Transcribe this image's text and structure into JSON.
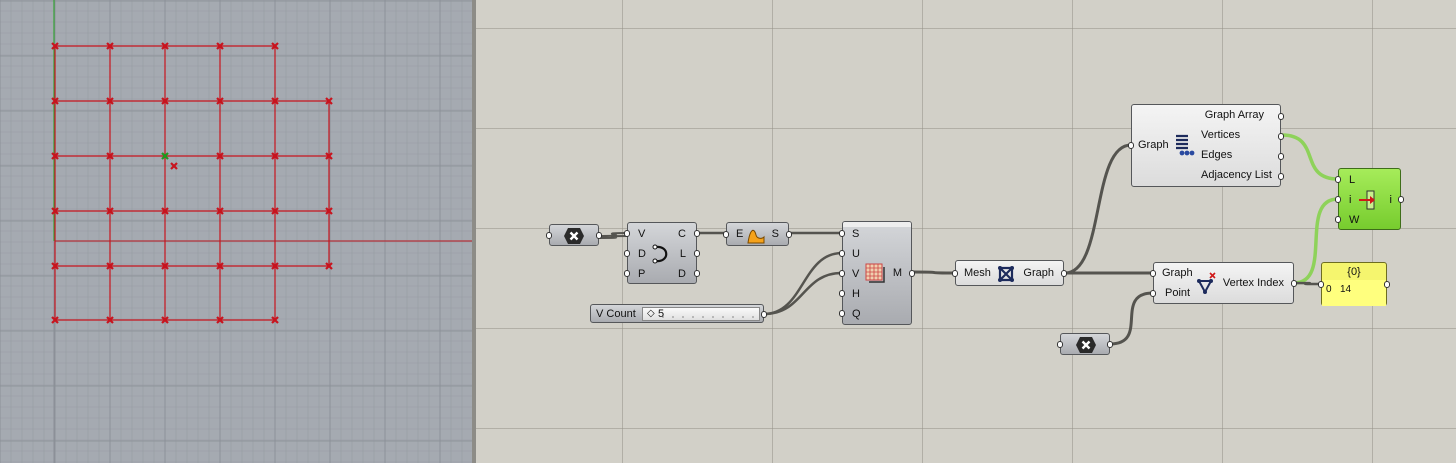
{
  "colors": {
    "viewport_bg": "#a5aab1",
    "grid_point": "#c8141e",
    "selected_point": "#1e9a1e",
    "canvas_bg": "#d2d0c8",
    "wire": "#55544f",
    "panel_yellow": "#f5f56e",
    "component_green": "#8fdc46"
  },
  "viewport": {
    "point_columns": 6,
    "point_rows": 6,
    "selected_point": "column 3, row 3"
  },
  "components": {
    "pt_param": {
      "icon": "cross-hex-icon"
    },
    "deconstruct": {
      "inputs": [
        "V",
        "D",
        "P"
      ],
      "outputs": [
        "C",
        "L",
        "D"
      ],
      "icon": "curve-icon"
    },
    "expression": {
      "input": "E",
      "output": "S",
      "icon": "orange-shape-icon"
    },
    "mesh_grid": {
      "inputs": [
        "S",
        "U",
        "V",
        "H",
        "Q"
      ],
      "output": "M",
      "icon": "mesh-grid-icon"
    },
    "v_count_slider": {
      "label": "V Count",
      "value": "5"
    },
    "mesh_to_graph": {
      "input": "Mesh",
      "output": "Graph",
      "icon": "mesh-graph-icon"
    },
    "deconstruct_graph": {
      "input": "Graph",
      "outputs": [
        "Graph Array",
        "Vertices",
        "Edges",
        "Adjacency List"
      ],
      "icon": "graph-list-icon"
    },
    "vertex_index": {
      "inputs": [
        "Graph",
        "Point"
      ],
      "output": "Vertex Index",
      "icon": "vertex-index-icon"
    },
    "list_item": {
      "inputs": [
        "L",
        "i",
        "W"
      ],
      "output": "i",
      "icon": "list-item-icon"
    },
    "pt_param_2": {
      "icon": "cross-hex-icon"
    },
    "panel": {
      "header": "{0}",
      "row_index": "0",
      "row_value": "14"
    }
  }
}
